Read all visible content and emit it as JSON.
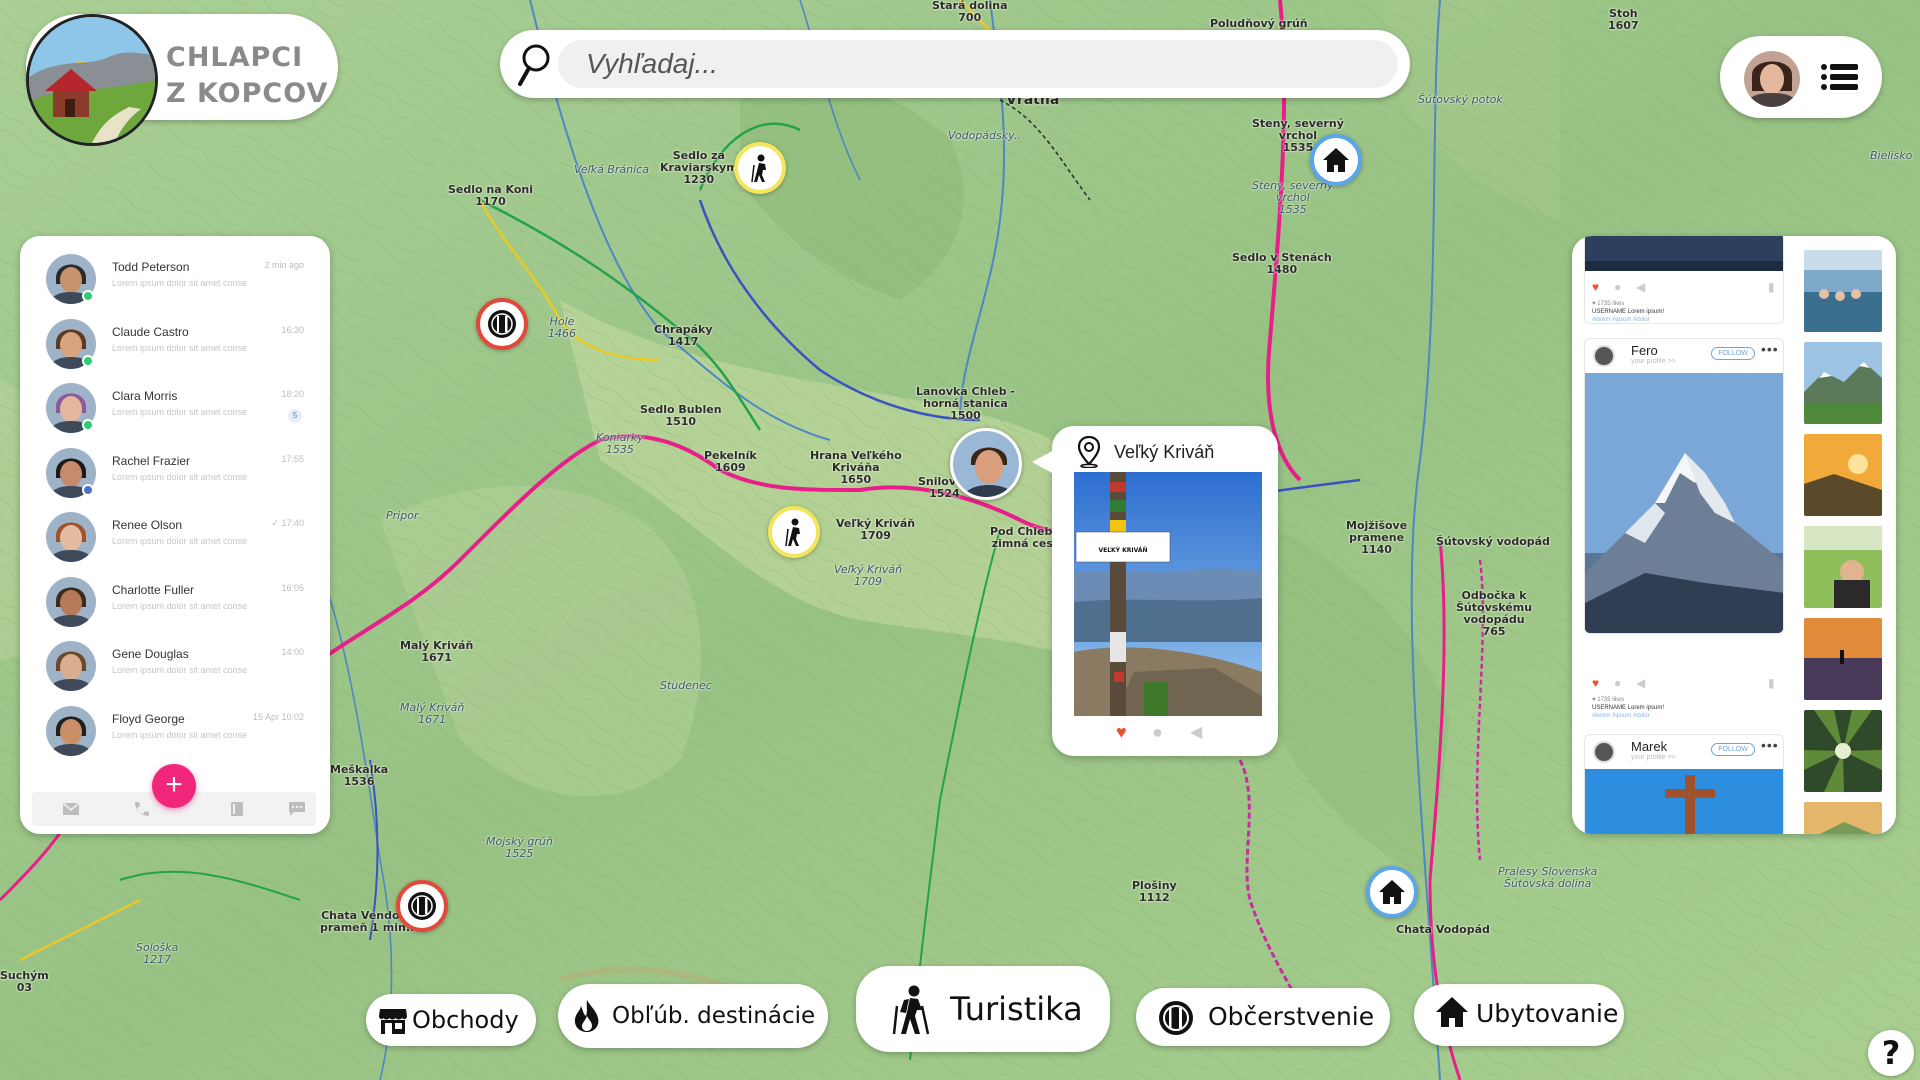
{
  "app": {
    "title_line1": "CHLAPCI",
    "title_line2": "Z KOPCOV"
  },
  "search": {
    "placeholder": "Vyhľadaj..."
  },
  "user_menu": {
    "avatar_icon": "user-avatar",
    "menu_icon": "list-menu-icon"
  },
  "chat": {
    "conversations": [
      {
        "name": "Todd Peterson",
        "message": "Lorem ipsum dolor sit amet conse",
        "time": "2 min ago",
        "status": "online",
        "status_color": "#2ecc71"
      },
      {
        "name": "Claude Castro",
        "message": "Lorem ipsum dolor sit amet conse",
        "time": "16:30",
        "status": "online",
        "status_color": "#2ecc71"
      },
      {
        "name": "Clara Morris",
        "message": "Lorem ipsum dolor sit amet conse",
        "time": "18:20",
        "status": "online",
        "status_color": "#2ecc71",
        "unread": "5"
      },
      {
        "name": "Rachel Frazier",
        "message": "Lorem ipsum dolor sit amet conse",
        "time": "17:55",
        "status": "away",
        "status_color": "#4a6fd1"
      },
      {
        "name": "Renee Olson",
        "message": "Lorem ipsum dolor sit amet conse",
        "time": "✓ 17:40"
      },
      {
        "name": "Charlotte Fuller",
        "message": "Lorem ipsum dolor sit amet conse",
        "time": "16:05"
      },
      {
        "name": "Gene Douglas",
        "message": "Lorem ipsum dolor sit amet conse",
        "time": "14:00"
      },
      {
        "name": "Floyd George",
        "message": "Lorem ipsum dolor sit amet conse",
        "time": "15 Apr 10:02"
      }
    ],
    "fab_label": "+",
    "tabbar_icons": [
      "mail-icon",
      "phone-icon",
      "book-icon",
      "chat-icon"
    ]
  },
  "feed": {
    "posts": [
      {
        "likes": "♥ 1735 likes",
        "caption": "USERNAME  Lorem ipsum!",
        "tags": "#lorem  #ipsum  #dolor"
      },
      {
        "user": "Fero",
        "subtitle": "your profile  >>",
        "follow": "FOLLOW",
        "likes": "♥ 1735 likes",
        "caption": "USERNAME  Lorem ipsum!",
        "tags": "#lorem  #ipsum  #dolor"
      },
      {
        "user": "Marek",
        "subtitle": "your profile  >>",
        "follow": "FOLLOW"
      }
    ]
  },
  "popup": {
    "title": "Veľký Kriváň",
    "sign_text": "VEĽKÝ KRIVÁŇ"
  },
  "categories": [
    {
      "label": "Obchody",
      "icon": "shop-icon"
    },
    {
      "label": "Obľúb. destinácie",
      "icon": "flame-icon"
    },
    {
      "label": "Turistika",
      "icon": "hiker-icon"
    },
    {
      "label": "Občerstvenie",
      "icon": "restaurant-icon"
    },
    {
      "label": "Ubytovanie",
      "icon": "house-icon"
    }
  ],
  "help": {
    "label": "?"
  },
  "map_labels": [
    {
      "text": "Vrátna",
      "big": true
    },
    {
      "text": "Poludňový grúň"
    },
    {
      "text": "Stoh\n1607"
    },
    {
      "text": "Stará dolina\n700"
    },
    {
      "text": "Sedlo za\nKraviarskym\n1230"
    },
    {
      "text": "Sedlo na Koni\n1170"
    },
    {
      "text": "Veľká Bránica",
      "italic": true
    },
    {
      "text": "Steny, severný\nvrchol\n1535"
    },
    {
      "text": "Steny, severný\nvrchol\n1535",
      "italic": true
    },
    {
      "text": "Sedlo v Stenách\n1480"
    },
    {
      "text": "Chrapáky\n1417"
    },
    {
      "text": "Hole\n1466",
      "italic": true
    },
    {
      "text": "Sedlo Bublen\n1510"
    },
    {
      "text": "Koniarky\n1535",
      "italic": true
    },
    {
      "text": "Pekelník\n1609"
    },
    {
      "text": "Hrana Veľkého\nKriváňa\n1650"
    },
    {
      "text": "Lanovka Chleb -\nhorná stanica\n1500"
    },
    {
      "text": "Snilovs..\n1524"
    },
    {
      "text": "Pod Chlebo..\nzimná cest.."
    },
    {
      "text": "Veľký Kriváň\n1709"
    },
    {
      "text": "Veľký Kriváň\n1709",
      "italic": true
    },
    {
      "text": "Mojžišove\npramene\n1140"
    },
    {
      "text": "Šútovský vodopád"
    },
    {
      "text": "Odbočka k\nŠútovskému\nvodopádu\n765"
    },
    {
      "text": "Malý Kriváň\n1671"
    },
    {
      "text": "Malý Kriváň\n1671",
      "italic": true
    },
    {
      "text": "Meškalka\n1536"
    },
    {
      "text": "Mojský grúň\n1525",
      "italic": true
    },
    {
      "text": "Chata Vendovka\nprameň 1 min...."
    },
    {
      "text": "Sološka\n1217",
      "italic": true
    },
    {
      "text": "Suchým\n03"
    },
    {
      "text": "Plošiny\n1112"
    },
    {
      "text": "Chata Vodopád"
    },
    {
      "text": "Pralesy Slovenska\nŠútovská dolina",
      "italic": true
    },
    {
      "text": "Pripor",
      "italic": true
    },
    {
      "text": "Studenec",
      "italic": true
    },
    {
      "text": "Šútovský potok",
      "italic": true
    },
    {
      "text": "Vodopádsky..",
      "italic": true
    },
    {
      "text": "Bielisko",
      "italic": true
    }
  ]
}
